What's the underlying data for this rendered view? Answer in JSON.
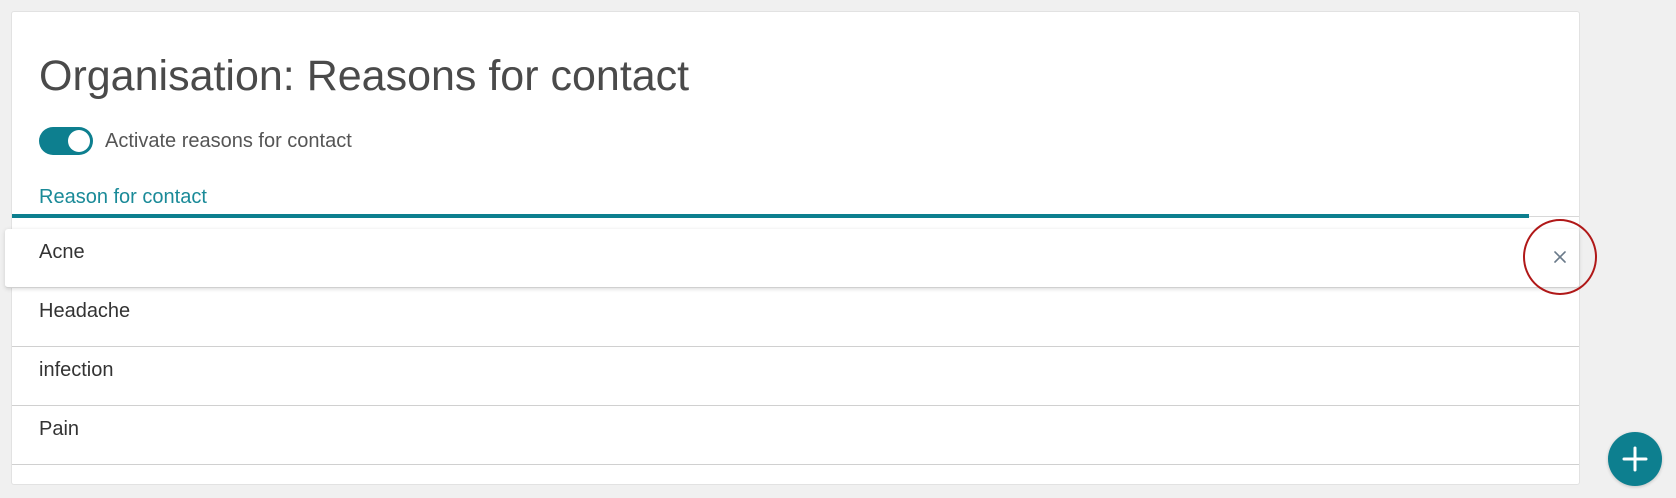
{
  "page": {
    "title": "Organisation: Reasons for contact"
  },
  "toggle": {
    "label": "Activate reasons for contact",
    "checked": true
  },
  "table": {
    "column_header": "Reason for contact",
    "rows": [
      {
        "label": "Acne"
      },
      {
        "label": "Headache"
      },
      {
        "label": "infection"
      },
      {
        "label": "Pain"
      }
    ]
  },
  "icons": {
    "delete": "close-icon",
    "add": "plus-icon"
  },
  "colors": {
    "accent": "#0d7f8f",
    "header_text": "#1a8a98",
    "highlight_ring": "#b01818"
  }
}
